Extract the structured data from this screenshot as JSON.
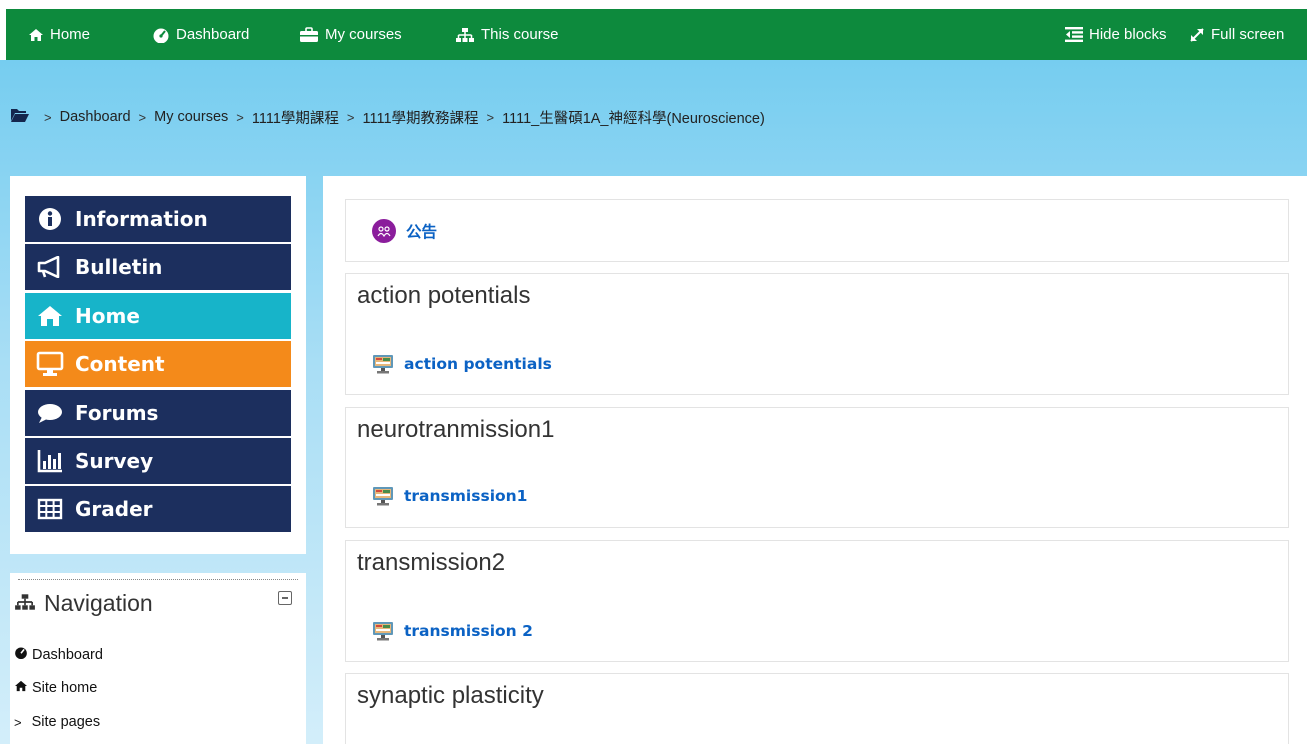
{
  "topbar": {
    "home": "Home",
    "dashboard": "Dashboard",
    "my_courses": "My courses",
    "this_course": "This course",
    "hide_blocks": "Hide blocks",
    "full_screen": "Full screen"
  },
  "breadcrumb": [
    "Dashboard",
    "My courses",
    "1111學期課程",
    "1111學期教務課程",
    "1111_生醫碩1A_神經科學(Neuroscience)"
  ],
  "menu": {
    "information": "Information",
    "bulletin": "Bulletin",
    "home": "Home",
    "content": "Content",
    "forums": "Forums",
    "survey": "Survey",
    "grader": "Grader"
  },
  "navigation": {
    "title": "Navigation",
    "items": [
      "Dashboard",
      "Site home",
      "Site pages"
    ]
  },
  "sections": [
    {
      "title": "",
      "activity": "公告"
    },
    {
      "title": "action potentials",
      "activity": "action potentials"
    },
    {
      "title": "neurotranmission1",
      "activity": "transmission1"
    },
    {
      "title": "transmission2",
      "activity": "transmission 2"
    },
    {
      "title": "synaptic plasticity",
      "activity": ""
    }
  ],
  "colors": {
    "topbar": "#0d8a3d",
    "menu_navy": "#1c2f5e",
    "menu_teal": "#17b4c9",
    "menu_orange": "#f48a1a",
    "link": "#0b62c4"
  },
  "icons": {
    "home": "home-icon",
    "dashboard": "tachometer-icon",
    "my_courses": "briefcase-icon",
    "this_course": "sitemap-icon",
    "hide_blocks": "outdent-icon",
    "full_screen": "expand-icon"
  }
}
